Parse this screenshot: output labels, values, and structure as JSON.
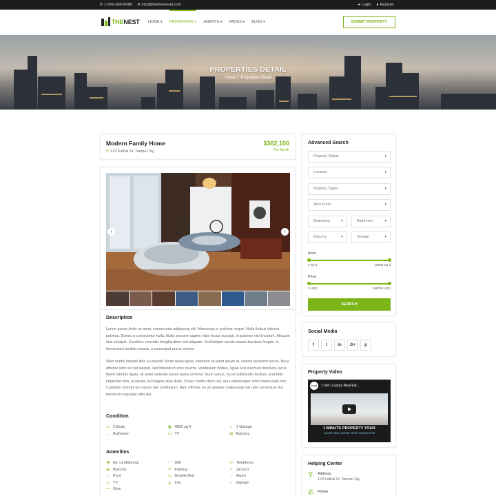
{
  "topbar": {
    "phone": "1-8X0-666-8X88",
    "email": "info@themevessel.com",
    "login": "Login",
    "register": "Register"
  },
  "header": {
    "logo_prefix": "THE",
    "logo_suffix": "NEST",
    "nav": [
      {
        "label": "HOME",
        "active": false
      },
      {
        "label": "PROPERTIES",
        "active": true
      },
      {
        "label": "AGENTS",
        "active": false
      },
      {
        "label": "PAGES",
        "active": false
      },
      {
        "label": "BLOG",
        "active": false
      }
    ],
    "submit_label": "SUBMIT PROPERTY"
  },
  "hero": {
    "title": "PROPERTIES DETAIL",
    "crumb_home": "Home",
    "crumb_sep": "/",
    "crumb_current": "Properties Detail"
  },
  "property": {
    "name": "Modern Family Home",
    "address": "123 Kathal St. Tampa City,",
    "price": "$362,100",
    "per": "Per Month"
  },
  "description": {
    "heading": "Description",
    "p1": "Lorem ipsum dolor sit amet, consectetur adipiscing elit. Maecenas in pulvinar neque. Nulla finibus lobortis pulvinar. Donec a consectetur nulla. Nulla posuere sapien vitae lectus suscipit, et pulvinar nisi tincidunt. Aliquam erat volutpat. Curabitur convallis fringilla diam sed aliquam. Sed tempor iaculis massa faucibus feugiat. In fermentum facilisis massa, a consequat purus viverra.",
    "p2": "Nam mattis lobortis felis eu blandit. Morbi tellus ligula, interdum sit amet ipsum et, viverra hendrerit lectus. Nunc efficitur sem vel est laoreet, sed bibendum eros viverra. Vestibulum finibus, ligula sed euismod tincidunt, lacus libero lobortis ligula, sit amet molestie ipsum purus ut tortor. Nunc varius, dui et sollicitudin facilisis, erat felis imperdiet felis, et iaculis dui magna vitae diam. Donec mattis diam nisl, quis ullamcorper enim malesuada non. Curabitur lobortis eu mauris nec vestibulum. Nam efficitur, ex ac semper malesuada nisi odio consequat dui, hendrerit vulputate odio dui."
  },
  "condition": {
    "heading": "Condition",
    "items": [
      {
        "icon": "bed-icon",
        "label": "3 Beds"
      },
      {
        "icon": "area-icon",
        "label": "4800 sq ft"
      },
      {
        "icon": "garage-icon",
        "label": "1 Garage"
      },
      {
        "icon": "bath-icon",
        "label": "Bathroom"
      },
      {
        "icon": "tv-icon",
        "label": "TV"
      },
      {
        "icon": "balcony-icon",
        "label": "Balcony"
      }
    ]
  },
  "amenities": {
    "heading": "Amenities",
    "items": [
      {
        "icon": "air-icon",
        "label": "Air conditioning"
      },
      {
        "icon": "wifi-icon",
        "label": "Wifi"
      },
      {
        "icon": "phone-icon",
        "label": "Telephone"
      },
      {
        "icon": "balcony-icon",
        "label": "Balcony"
      },
      {
        "icon": "parking-icon",
        "label": "Parking"
      },
      {
        "icon": "jacuzzi-icon",
        "label": "Jacuzzi"
      },
      {
        "icon": "pool-icon",
        "label": "Pool"
      },
      {
        "icon": "bed-icon",
        "label": "Double Bed"
      },
      {
        "icon": "alarm-icon",
        "label": "Alarm"
      },
      {
        "icon": "tv-icon",
        "label": "TV"
      },
      {
        "icon": "iron-icon",
        "label": "Iron"
      },
      {
        "icon": "garage-icon",
        "label": "Garage"
      },
      {
        "icon": "gym-icon",
        "label": "Gym"
      }
    ]
  },
  "search": {
    "heading": "Advanced Search",
    "status": "Property Status",
    "location": "Location",
    "types": "Property Types",
    "area_from": "Area From",
    "bedrooms": "Bedrooms",
    "bathroom": "Bathroom",
    "balcony": "Balcony",
    "garage": "Garage",
    "area_label": "Area",
    "area_min": "0 Sq ft",
    "area_max": "10000 Sq ft",
    "price_label": "Price",
    "price_min": "0 USD",
    "price_max": "150000 USD",
    "button": "SEARCH"
  },
  "social": {
    "heading": "Social Media",
    "items": [
      {
        "icon": "facebook-icon",
        "glyph": "f"
      },
      {
        "icon": "twitter-icon",
        "glyph": "t"
      },
      {
        "icon": "linkedin-icon",
        "glyph": "in"
      },
      {
        "icon": "google-plus-icon",
        "glyph": "G+"
      },
      {
        "icon": "pinterest-icon",
        "glyph": "p"
      }
    ]
  },
  "video": {
    "heading": "Property Video",
    "title": "1 min | Luxury Real Est...",
    "channel": "TOUR",
    "caption": "1 MINUTE PROPERTY TOUR",
    "sub": "LUXURY REAL ESTATE VIDEO PRODUCTION"
  },
  "help": {
    "heading": "Helping Center",
    "address_label": "Address",
    "address": "123 Kathal St. Tampa City,",
    "phone_label": "Phone"
  },
  "colors": {
    "accent": "#7cb518",
    "topbar": "#1d1d1d"
  }
}
